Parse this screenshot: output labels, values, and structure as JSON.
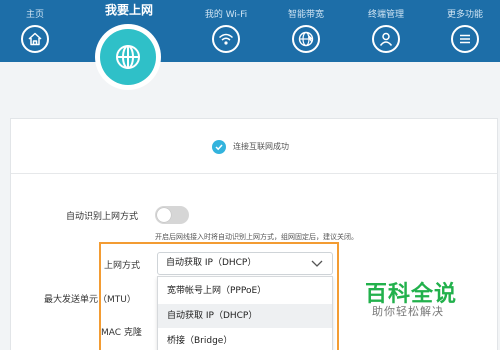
{
  "nav": {
    "home": {
      "label": "主页",
      "icon": "home-icon"
    },
    "internet": {
      "label": "我要上网",
      "icon": "globe-icon"
    },
    "wifi": {
      "label": "我的 Wi-Fi",
      "icon": "wifi-icon"
    },
    "bandwidth": {
      "label": "智能带宽",
      "icon": "speed-globe-icon"
    },
    "devices": {
      "label": "终端管理",
      "icon": "user-icon"
    },
    "more": {
      "label": "更多功能",
      "icon": "menu-icon"
    }
  },
  "status": {
    "text": "连接互联网成功",
    "icon": "check-icon"
  },
  "form": {
    "auto_detect_label": "自动识别上网方式",
    "auto_detect_on": false,
    "hint": "开启后网线接入时将自动识别上网方式，组网固定后，建议关闭。",
    "mode_label": "上网方式",
    "mode_value": "自动获取 IP（DHCP）",
    "mtu_label": "最大发送单元（MTU）",
    "mac_label": "MAC 克隆"
  },
  "dropdown": {
    "options": [
      {
        "label": "宽带帐号上网（PPPoE）",
        "selected": false
      },
      {
        "label": "自动获取 IP（DHCP）",
        "selected": true
      },
      {
        "label": "桥接（Bridge）",
        "selected": false
      }
    ]
  },
  "watermark": {
    "title": "百科全说",
    "subtitle": "助你轻松解决"
  },
  "colors": {
    "nav_bg": "#1d6ea8",
    "active_tab": "#2fc0c8",
    "highlight_box": "#f39c33",
    "check": "#33b3dd",
    "watermark": "#22b14c"
  }
}
